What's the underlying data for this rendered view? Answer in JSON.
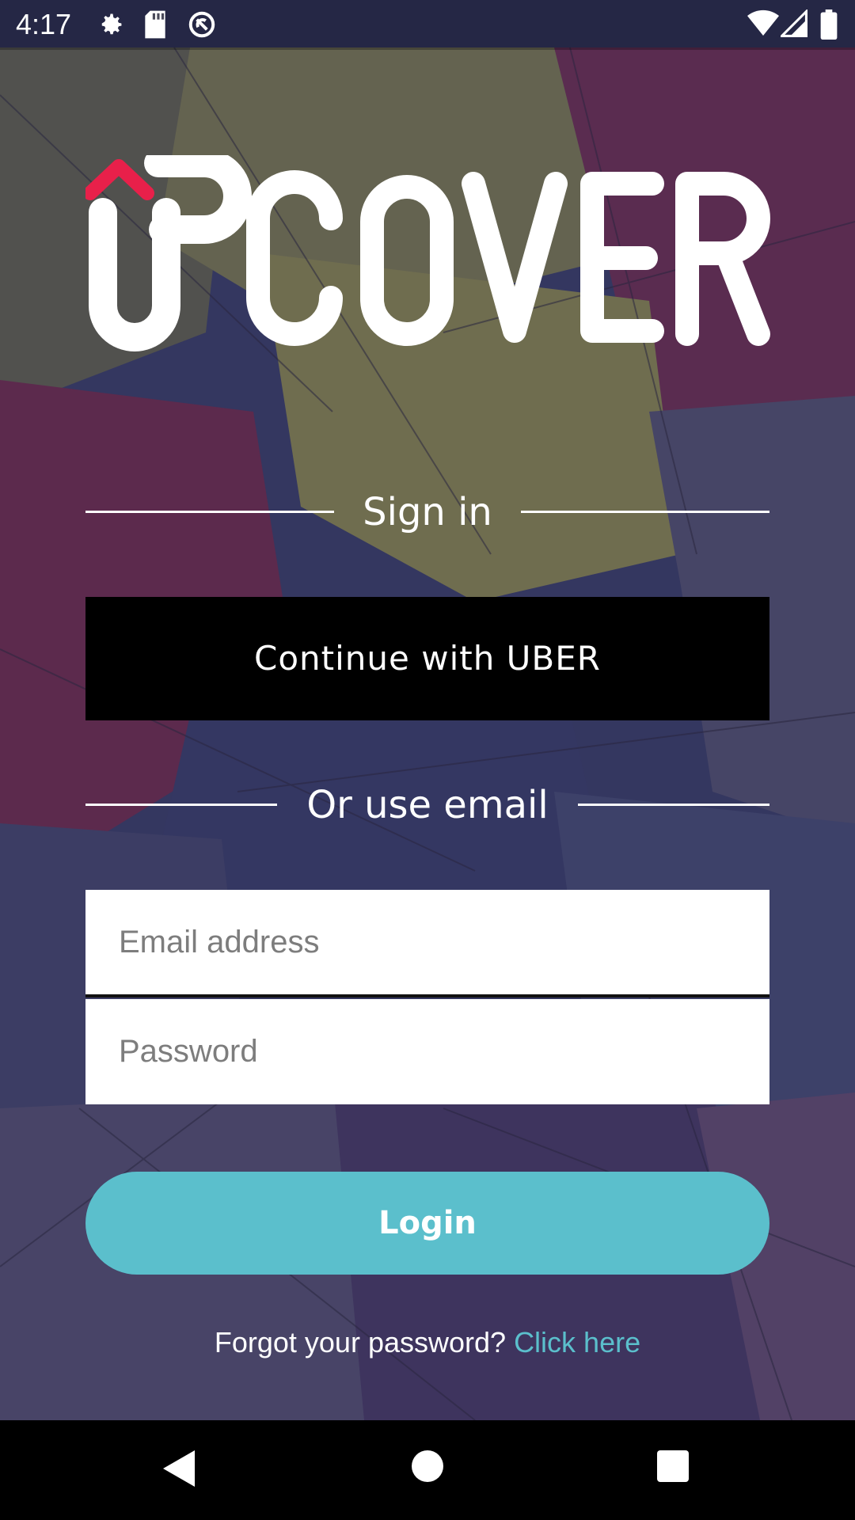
{
  "status_bar": {
    "time": "4:17",
    "icons": [
      "gear-icon",
      "sd-card-icon",
      "sync-icon",
      "wifi-icon",
      "signal-icon",
      "battery-icon"
    ]
  },
  "logo": {
    "text": "UPCOVER",
    "accent_color": "#e8204a"
  },
  "sign_in": {
    "heading": "Sign in",
    "uber_button_label": "Continue with UBER",
    "email_heading": "Or use email"
  },
  "form": {
    "email_placeholder": "Email address",
    "password_placeholder": "Password",
    "login_label": "Login"
  },
  "forgot": {
    "text": "Forgot your password?",
    "link_label": "Click here"
  },
  "nav_bar": {
    "icons": [
      "back-icon",
      "home-icon",
      "recents-icon"
    ]
  },
  "colors": {
    "accent": "#5bbfcc",
    "uber_bg": "#000000",
    "logo_accent": "#e8204a"
  }
}
